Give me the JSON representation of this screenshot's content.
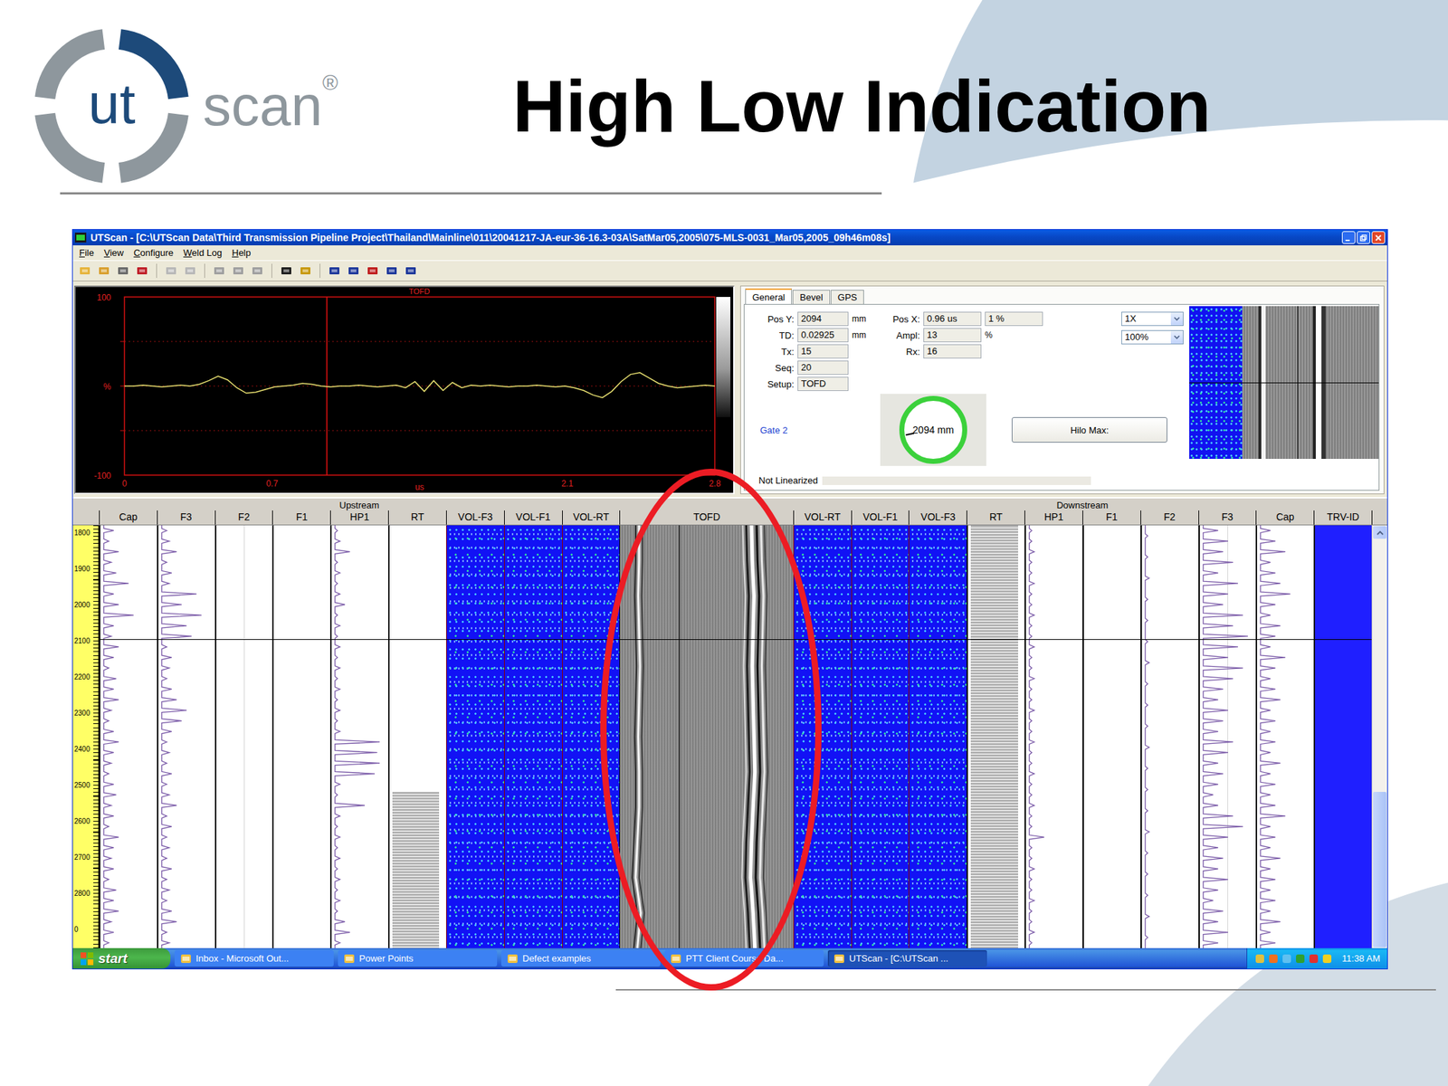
{
  "slide": {
    "title": "High Low Indication",
    "logo": {
      "inner": "ut",
      "outer": "scan",
      "mark": "®"
    }
  },
  "window": {
    "title": "UTScan - [C:\\UTScan Data\\Third Transmission Pipeline Project\\Thailand\\Mainline\\011\\20041217-JA-eur-36-16.3-03A\\SatMar05,2005\\075-MLS-0031_Mar05,2005_09h46m08s]"
  },
  "menu": [
    "File",
    "View",
    "Configure",
    "Weld Log",
    "Help"
  ],
  "ascan": {
    "label": "TOFD",
    "y_ticks": [
      "100",
      "%",
      "-100"
    ],
    "x_ticks": [
      "0",
      "0.7",
      "us",
      "2.1",
      "2.8"
    ],
    "cursor_us": 0.96,
    "values": [
      0,
      0,
      1,
      0,
      -1,
      0,
      1,
      0,
      2,
      6,
      11,
      7,
      -2,
      -8,
      -7,
      -4,
      -1,
      0,
      1,
      3,
      2,
      0,
      -1,
      0,
      0,
      1,
      0,
      -1,
      0,
      1,
      -2,
      5,
      -6,
      6,
      -5,
      4,
      -2,
      1,
      0,
      1,
      0,
      -1,
      0,
      0,
      1,
      0,
      -1,
      0,
      -2,
      -5,
      -10,
      -13,
      -6,
      5,
      13,
      15,
      9,
      3,
      0,
      -2,
      -1,
      0,
      1,
      0
    ]
  },
  "info": {
    "tabs": [
      {
        "label": "General",
        "selected": true
      },
      {
        "label": "Bevel",
        "selected": false
      },
      {
        "label": "GPS",
        "selected": false
      }
    ],
    "fields_left": [
      {
        "label": "Pos Y:",
        "value": "2094",
        "unit": "mm"
      },
      {
        "label": "TD:",
        "value": "0.02925",
        "unit": "mm"
      },
      {
        "label": "Tx:",
        "value": "15",
        "unit": ""
      },
      {
        "label": "Seq:",
        "value": "20",
        "unit": ""
      },
      {
        "label": "Setup:",
        "value": "TOFD",
        "unit": ""
      }
    ],
    "fields_right": [
      {
        "label": "Pos X:",
        "value": "0.96 us",
        "extra": "1 %",
        "unit": ""
      },
      {
        "label": "Ampl:",
        "value": "13",
        "extra": "",
        "unit": "%"
      },
      {
        "label": "Rx:",
        "value": "16",
        "extra": "",
        "unit": ""
      }
    ],
    "selects": [
      "1X",
      "100%"
    ],
    "gate": "Gate 2",
    "dial": "2094 mm",
    "button": "Hilo Max:",
    "status": "Not Linearized"
  },
  "strip": {
    "groups": [
      {
        "label": "Upstream",
        "side": "upstream"
      },
      {
        "label": "Downstream",
        "side": "downstream"
      }
    ],
    "ruler": [
      "1800",
      "1900",
      "2000",
      "2100",
      "2200",
      "2300",
      "2400",
      "2500",
      "2600",
      "2700",
      "2800",
      "0"
    ],
    "cursor": 2094,
    "scrollbar": {
      "thumb_start": 0.62,
      "level": 0.38
    },
    "tofd": {
      "lateral": [
        0.11,
        0.11,
        0.105,
        0.11,
        0.115,
        0.11,
        0.105,
        0.11,
        0.11,
        0.1,
        0.09,
        0.12,
        0.1
      ],
      "backwall": [
        0.76,
        0.765,
        0.775,
        0.77,
        0.765,
        0.77,
        0.775,
        0.78,
        0.77,
        0.76,
        0.755,
        0.77,
        0.78
      ]
    },
    "columns": [
      {
        "name": "Cap",
        "kind": "strip",
        "side": "upstream",
        "trace": [
          0.2,
          0.1,
          0.3,
          0.15,
          0.25,
          0.5,
          0.2,
          0.3,
          0.6,
          0.2,
          0.15,
          0.3,
          0.2,
          0.1,
          0.25,
          0.2,
          0.3,
          0.15,
          0.1,
          0.2,
          0.3,
          0.2,
          0.15,
          0.1,
          0.2,
          0.25,
          0.15,
          0.2,
          0.1,
          0.3,
          0.2,
          0.15,
          0.2,
          0.1,
          0.25,
          0.2,
          0.3,
          0.15,
          0.2,
          0.1
        ]
      },
      {
        "name": "F3",
        "kind": "strip",
        "side": "upstream",
        "trace": [
          0.1,
          0.15,
          0.3,
          0.1,
          0.2,
          0.15,
          0.7,
          0.4,
          0.8,
          0.5,
          0.6,
          0.1,
          0.2,
          0.15,
          0.1,
          0.2,
          0.3,
          0.5,
          0.4,
          0.2,
          0.1,
          0.15,
          0.1,
          0.2,
          0.1,
          0.15,
          0.3,
          0.1,
          0.2,
          0.1,
          0.15,
          0.1,
          0.2,
          0.1,
          0.15,
          0.1,
          0.2,
          0.3,
          0.1,
          0.15
        ]
      },
      {
        "name": "F2",
        "kind": "strip",
        "side": "upstream",
        "trace": []
      },
      {
        "name": "F1",
        "kind": "strip",
        "side": "upstream",
        "trace": []
      },
      {
        "name": "HP1",
        "kind": "strip",
        "side": "upstream",
        "trace": [
          0.05,
          0.1,
          0.3,
          0.05,
          0.1,
          0.05,
          0.1,
          0.2,
          0.05,
          0.1,
          0.05,
          0.1,
          0.05,
          0.1,
          0.05,
          0.1,
          0.05,
          0.1,
          0.05,
          0.1,
          0.9,
          0.85,
          0.9,
          0.8,
          0.1,
          0.05,
          0.6,
          0.1,
          0.05,
          0.1,
          0.05,
          0.1,
          0.05,
          0.1,
          0.05,
          0.1,
          0.05,
          0.2,
          0.3,
          0.1
        ]
      },
      {
        "name": "RT",
        "kind": "rt",
        "side": "upstream",
        "level": 0.37
      },
      {
        "name": "VOL-F3",
        "kind": "vol",
        "side": "upstream"
      },
      {
        "name": "VOL-F1",
        "kind": "vol",
        "side": "upstream"
      },
      {
        "name": "VOL-RT",
        "kind": "vol",
        "side": "upstream"
      },
      {
        "name": "TOFD",
        "kind": "tofd",
        "side": "center"
      },
      {
        "name": "VOL-RT",
        "kind": "vol",
        "side": "downstream"
      },
      {
        "name": "VOL-F1",
        "kind": "vol",
        "side": "downstream"
      },
      {
        "name": "VOL-F3",
        "kind": "vol",
        "side": "downstream"
      },
      {
        "name": "RT",
        "kind": "rt",
        "side": "downstream",
        "level": 1
      },
      {
        "name": "HP1",
        "kind": "strip",
        "side": "downstream",
        "trace": [
          0.05,
          0.05,
          0.1,
          0.05,
          0.05,
          0.1,
          0.05,
          0.05,
          0.1,
          0.05,
          0.05,
          0.1,
          0.05,
          0.05,
          0.1,
          0.05,
          0.05,
          0.1,
          0.05,
          0.05,
          0.1,
          0.05,
          0.05,
          0.1,
          0.05,
          0.05,
          0.1,
          0.05,
          0.05,
          0.3,
          0.05,
          0.05,
          0.1,
          0.05,
          0.05,
          0.1,
          0.05,
          0.05,
          0.1,
          0.05
        ]
      },
      {
        "name": "F1",
        "kind": "strip",
        "side": "downstream",
        "trace": []
      },
      {
        "name": "F2",
        "kind": "strip",
        "side": "downstream",
        "trace": [
          0.05,
          0.05,
          0.08,
          0.05,
          0.05,
          0.05,
          0.08,
          0.05,
          0.05,
          0.05,
          0.08,
          0.05,
          0.05,
          0.05,
          0.08,
          0.05,
          0.05,
          0.05,
          0.08,
          0.05
        ]
      },
      {
        "name": "F3",
        "kind": "strip",
        "side": "downstream",
        "trace": [
          0.3,
          0.5,
          0.4,
          0.6,
          0.3,
          0.7,
          0.5,
          0.4,
          0.8,
          0.6,
          0.9,
          0.7,
          0.5,
          0.8,
          0.6,
          0.4,
          0.3,
          0.5,
          0.4,
          0.3,
          0.6,
          0.5,
          0.3,
          0.4,
          0.3,
          0.2,
          0.3,
          0.6,
          0.8,
          0.5,
          0.3,
          0.4,
          0.3,
          0.5,
          0.3,
          0.2,
          0.4,
          0.3,
          0.5,
          0.3
        ]
      },
      {
        "name": "Cap",
        "kind": "strip",
        "side": "downstream",
        "trace": [
          0.2,
          0.3,
          0.5,
          0.2,
          0.3,
          0.4,
          0.6,
          0.3,
          0.2,
          0.4,
          0.3,
          0.2,
          0.5,
          0.3,
          0.2,
          0.3,
          0.4,
          0.2,
          0.3,
          0.2,
          0.3,
          0.2,
          0.4,
          0.2,
          0.3,
          0.2,
          0.3,
          0.5,
          0.2,
          0.3,
          0.2,
          0.4,
          0.2,
          0.3,
          0.2,
          0.3,
          0.2,
          0.4,
          0.2,
          0.3
        ]
      },
      {
        "name": "TRV-ID",
        "kind": "trv",
        "side": "downstream"
      }
    ]
  },
  "taskbar": {
    "start": "start",
    "items": [
      {
        "label": "Inbox - Microsoft Out...",
        "selected": false
      },
      {
        "label": "Power Points",
        "selected": false
      },
      {
        "label": "Defect examples",
        "selected": false
      },
      {
        "label": "PTT Client Course Da...",
        "selected": false
      },
      {
        "label": "UTScan - [C:\\UTScan ...",
        "selected": true
      }
    ],
    "time": "11:38 AM"
  }
}
